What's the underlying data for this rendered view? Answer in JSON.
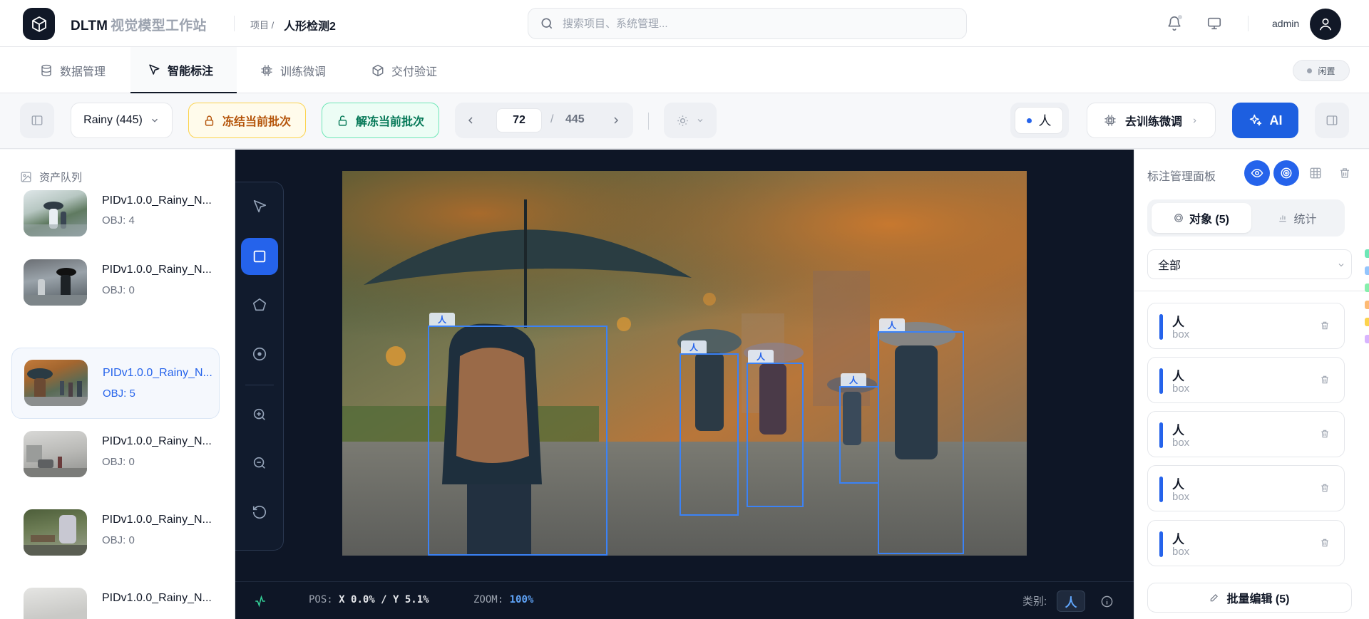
{
  "header": {
    "app_name": "DLTM",
    "app_subtitle": "视觉模型工作站",
    "breadcrumb_label": "项目 /",
    "project_name": "人形检测2",
    "search_placeholder": "搜索项目、系统管理...",
    "username": "admin"
  },
  "tabs": [
    {
      "label": "数据管理",
      "icon": "database-icon"
    },
    {
      "label": "智能标注",
      "icon": "cursor-icon",
      "active": true
    },
    {
      "label": "训练微调",
      "icon": "chip-icon"
    },
    {
      "label": "交付验证",
      "icon": "box-icon"
    }
  ],
  "status_badge": "闲置",
  "toolbar": {
    "dataset": "Rainy (445)",
    "freeze_label": "冻结当前批次",
    "unfreeze_label": "解冻当前批次",
    "page_current": "72",
    "page_sep": "/",
    "page_total": "445",
    "class_label": "人",
    "train_label": "去训练微调",
    "ai_label": "AI"
  },
  "asset_queue": {
    "title": "资产队列",
    "items": [
      {
        "name": "PIDv1.0.0_Rainy_N...",
        "obj": "OBJ: 4"
      },
      {
        "name": "PIDv1.0.0_Rainy_N...",
        "obj": "OBJ: 0"
      },
      {
        "name": "PIDv1.0.0_Rainy_N...",
        "obj": "OBJ: 5",
        "active": true
      },
      {
        "name": "PIDv1.0.0_Rainy_N...",
        "obj": "OBJ: 0"
      },
      {
        "name": "PIDv1.0.0_Rainy_N...",
        "obj": "OBJ: 0"
      },
      {
        "name": "PIDv1.0.0_Rainy_N...",
        "obj": ""
      }
    ]
  },
  "canvas": {
    "box_label": "人",
    "pos_label": "POS:",
    "pos_value": "X 0.0% / Y 5.1%",
    "zoom_label": "ZOOM:",
    "zoom_value": "100%",
    "category_label": "类别:",
    "category_value": "人"
  },
  "panel": {
    "title": "标注管理面板",
    "tab_objects": "对象 (5)",
    "tab_stats": "统计",
    "filter_value": "全部",
    "objects": [
      {
        "name": "人",
        "type": "box"
      },
      {
        "name": "人",
        "type": "box"
      },
      {
        "name": "人",
        "type": "box"
      },
      {
        "name": "人",
        "type": "box"
      },
      {
        "name": "人",
        "type": "box"
      }
    ],
    "batch_edit": "批量编辑 (5)"
  },
  "colors": {
    "accent": "#2563eb",
    "dark": "#111827",
    "canvas_bg": "#0e1626",
    "freeze": "#b45309",
    "unfreeze": "#047857"
  }
}
